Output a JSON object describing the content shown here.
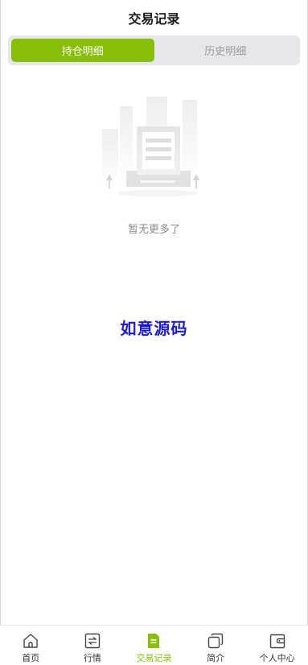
{
  "header": {
    "title": "交易记录"
  },
  "tabs": [
    {
      "label": "持仓明细",
      "active": true
    },
    {
      "label": "历史明细",
      "active": false
    }
  ],
  "empty_state": {
    "icon": "document-box-illustration",
    "message": "暂无更多了"
  },
  "watermark": {
    "text": "如意源码"
  },
  "tabbar": {
    "items": [
      {
        "label": "首页",
        "icon": "home-icon"
      },
      {
        "label": "行情",
        "icon": "exchange-icon"
      },
      {
        "label": "交易记录",
        "icon": "record-icon",
        "active": true
      },
      {
        "label": "简介",
        "icon": "copy-icon"
      },
      {
        "label": "个人中心",
        "icon": "wallet-icon"
      }
    ]
  },
  "colors": {
    "accent": "#86be08",
    "tab_track": "#e6e7ec",
    "watermark": "#1b1bd6",
    "muted": "#8b8b8b"
  }
}
